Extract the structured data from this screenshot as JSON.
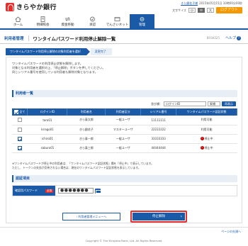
{
  "header": {
    "bank_name": "きらやか銀行",
    "user_name": "きら銀花子様",
    "last_login": "2015年05月15日 10時00分00秒",
    "char_size_label": "文字サイズ",
    "size_small": "小",
    "size_medium": "中",
    "size_large": "大",
    "logout_label": "ログアウト"
  },
  "nav": {
    "items": [
      {
        "label": "ホーム",
        "icon": "home-icon"
      },
      {
        "label": "明細照会",
        "icon": "statement-icon"
      },
      {
        "label": "資金移動",
        "icon": "transfer-icon"
      },
      {
        "label": "承認",
        "icon": "approval-icon"
      },
      {
        "label": "でんさいネット",
        "icon": "densai-icon"
      },
      {
        "label": "管理",
        "icon": "admin-icon"
      }
    ]
  },
  "title": {
    "category": "利用者管理",
    "page_title": "ワンタイムパスワード利用停止解除一覧",
    "page_id": "BRSK025",
    "help_label": "ヘルプ"
  },
  "steps": {
    "current": "ワンタイムパスワード利用停止解除の対象利用者を選択",
    "next": "変更完了"
  },
  "description": {
    "line1": "ワンタイムパスワードの利用停止状態を解除します。",
    "line2": "対象となる利用者を選択の上、「停止解除」ボタンを押してください。",
    "line3": "同じシリアル番号を使用している利用者も解除対象となります。"
  },
  "users_section": {
    "heading": "利用者一覧",
    "sort_label": "並び順：",
    "sort_value": "ログインID",
    "order_value": "昇順",
    "resort_label": "再表示",
    "columns": [
      "全て",
      "ログインID",
      "利用者名",
      "利用者区分",
      "シリアル番号",
      "ワンタイムパスワード認証状態"
    ],
    "rows": [
      {
        "login_id": "taro01",
        "name": "きら泰太郎",
        "type": "一般ユーザ",
        "serial": "11111111",
        "status": "利用可能",
        "checked": false,
        "stopped": false
      },
      {
        "login_id": "kirago01",
        "name": "きら銀花子",
        "type": "マスターユーザ",
        "serial": "22222222",
        "status": "利用可能",
        "checked": false,
        "stopped": false
      },
      {
        "login_id": "ichiro01",
        "name": "きら泰一郎",
        "type": "一般ユーザ",
        "serial": "33333333",
        "status": "停止中",
        "checked": true,
        "stopped": true
      },
      {
        "login_id": "saburo01",
        "name": "きら泰三郎",
        "type": "一般ユーザ",
        "serial": "44444444",
        "status": "停止中",
        "checked": true,
        "stopped": true
      }
    ]
  },
  "note": {
    "line1": "※ワンタイムパスワードが停止中の利用者は、「ワンタイムパスワード認証状態」欄を「停止中」で表示しています。",
    "line2": "ただし、トークンの失効が反映されない場合は、現在のワンタイムパスワード認証状態を表示しています。"
  },
  "auth": {
    "heading": "認証項目",
    "label": "確認用パスワード",
    "required": "必須",
    "value": "●●●●●●●"
  },
  "buttons": {
    "back": "利用者管理メニューへ",
    "stop_release": "停止解除"
  },
  "footer": {
    "pagetop": "ページの先頭へ",
    "copyright": "Copyright © The Kirayaka Bank, Ltd. All Rights Reserved."
  }
}
